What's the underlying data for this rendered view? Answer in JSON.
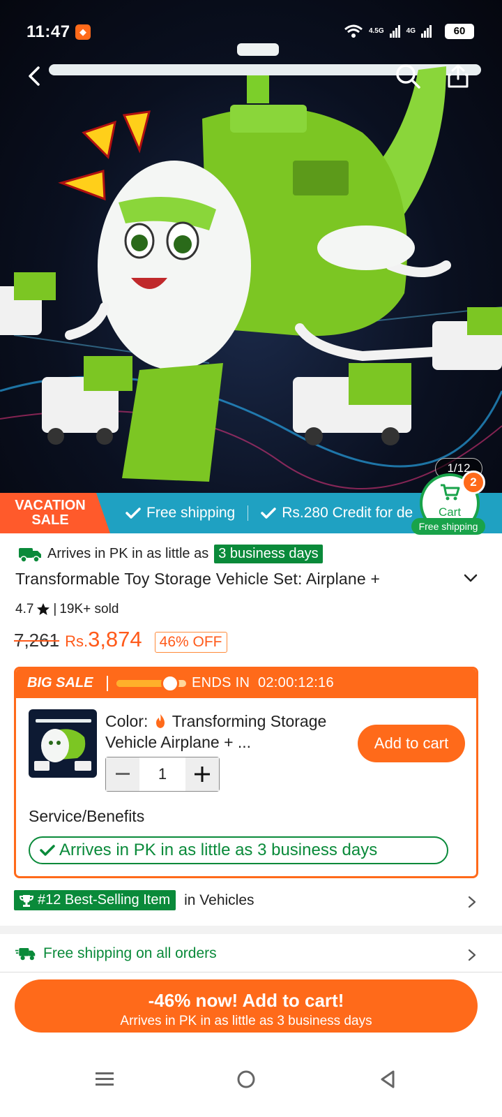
{
  "status_bar": {
    "time": "11:47",
    "network_1": "4.5G",
    "network_2": "4G",
    "battery": "60"
  },
  "hero": {
    "pager": "1/12",
    "icons": [
      "back-icon",
      "search-icon",
      "share-icon"
    ]
  },
  "promo": {
    "badge_line1": "VACATION",
    "badge_line2": "SALE",
    "item1": "Free shipping",
    "item2": "Rs.280 Credit for de",
    "accent": "#1fa1c2",
    "badge_color": "#ff5a2b"
  },
  "cart_float": {
    "label": "Cart",
    "count": "2",
    "shipping": "Free shipping"
  },
  "product": {
    "arrival_prefix": "Arrives in PK in as little as",
    "arrival_days": "3 business days",
    "title": "Transformable Toy Storage Vehicle Set: Airplane +",
    "rating": "4.7",
    "sold": "19K+ sold",
    "old_price": "7,261",
    "currency": "Rs.",
    "price": "3,874",
    "discount": "46% OFF"
  },
  "sale": {
    "title": "BIG SALE",
    "ends_label": "ENDS IN",
    "countdown": "02:00:12:16",
    "progress": 0.75,
    "color_label": "Color:",
    "color_value": "Transforming Storage Vehicle Airplane + ...",
    "add_to_cart": "Add to cart",
    "quantity": "1",
    "service_label": "Service/Benefits",
    "service_pill": "Arrives in PK in as little as 3 business days",
    "accent": "#ff6a1a"
  },
  "best_seller": {
    "tag": "#12 Best-Selling Item",
    "category": "in Vehicles"
  },
  "shipping": {
    "text": "Free shipping on all orders",
    "color": "#0a8a3a"
  },
  "cta": {
    "main": "-46% now! Add to cart!",
    "sub": "Arrives in PK in as little as 3 business days"
  },
  "nav": {
    "icons": [
      "menu-icon",
      "home-icon",
      "back-triangle-icon"
    ]
  }
}
